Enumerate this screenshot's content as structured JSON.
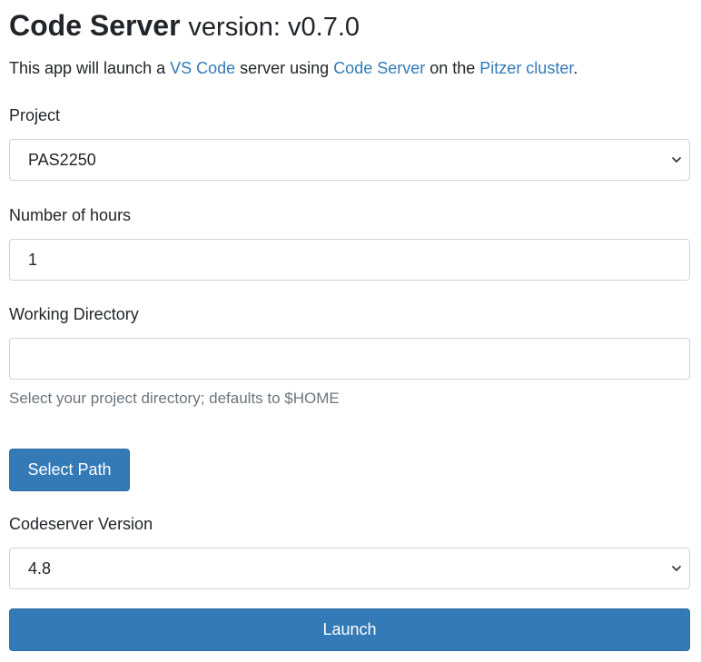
{
  "header": {
    "app_name": "Code Server",
    "version_label": "version: v0.7.0"
  },
  "intro": {
    "prefix": "This app will launch a ",
    "vscode_link": "VS Code",
    "middle": " server using ",
    "codeserver_link": "Code Server",
    "on_the": " on the ",
    "cluster_link": "Pitzer cluster",
    "suffix": "."
  },
  "form": {
    "project": {
      "label": "Project",
      "selected": "PAS2250"
    },
    "hours": {
      "label": "Number of hours",
      "value": "1"
    },
    "working_directory": {
      "label": "Working Directory",
      "value": "",
      "help": "Select your project directory; defaults to $HOME"
    },
    "select_path_label": "Select Path",
    "codeserver_version": {
      "label": "Codeserver Version",
      "selected": "4.8"
    },
    "launch_label": "Launch"
  },
  "icons": {
    "select_arrow": "chevron-down-icon"
  },
  "colors": {
    "link": "#337ab7",
    "button": "#337ab7",
    "help_text": "#6c757d"
  }
}
